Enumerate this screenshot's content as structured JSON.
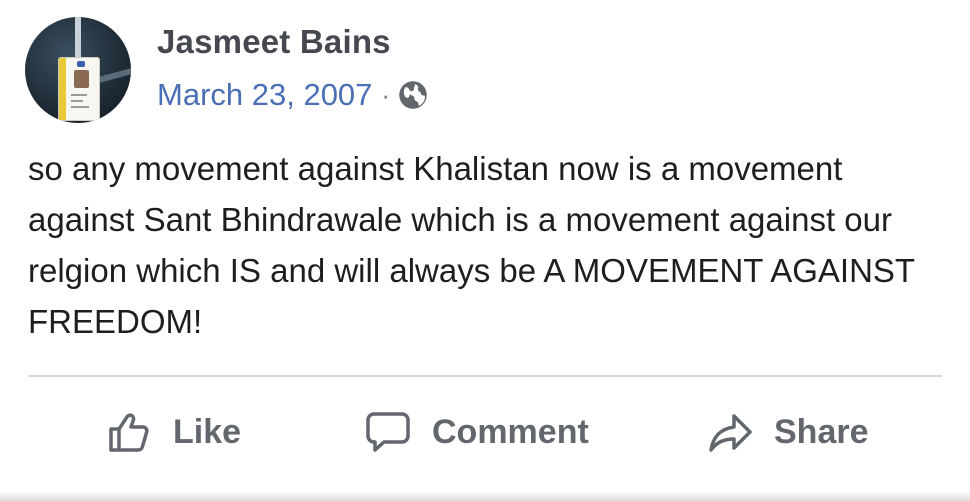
{
  "post": {
    "author": "Jasmeet Bains",
    "date": "March 23, 2007",
    "separator": "·",
    "privacy_icon": "globe-icon",
    "text": "so any movement against Khalistan now is a movement against Sant Bhindrawale which is a movement against our relgion which IS and will always be A MOVEMENT AGAINST FREEDOM!"
  },
  "actions": {
    "like": {
      "label": "Like",
      "icon": "thumbs-up-icon"
    },
    "comment": {
      "label": "Comment",
      "icon": "speech-bubble-icon"
    },
    "share": {
      "label": "Share",
      "icon": "share-arrow-icon"
    }
  },
  "colors": {
    "author": "#454850",
    "date_link": "#4a6fb5",
    "body_text": "#1c1e21",
    "action_text": "#62666d",
    "divider": "#d7d9dc"
  }
}
